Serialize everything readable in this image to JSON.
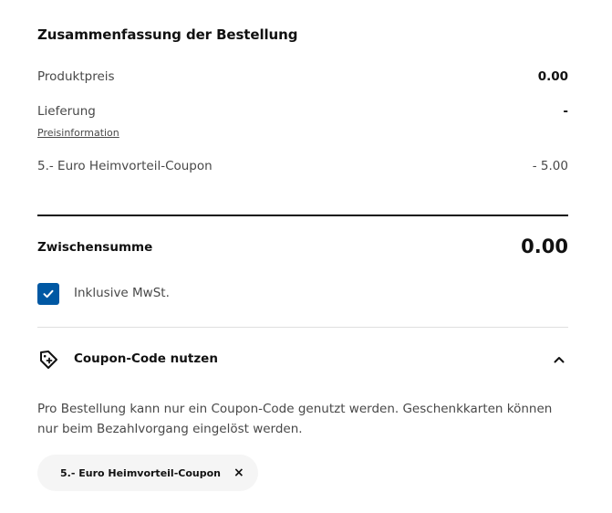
{
  "summary": {
    "title": "Zusammenfassung der Bestellung",
    "rows": [
      {
        "label": "Produktpreis",
        "value": "0.00"
      },
      {
        "label": "Lieferung",
        "value": "-",
        "link": "Preisinformation"
      },
      {
        "label": "5.- Euro Heimvorteil-Coupon",
        "value": "- 5.00"
      }
    ]
  },
  "subtotal": {
    "label": "Zwischensumme",
    "value": "0.00"
  },
  "vat": {
    "label": "Inklusive MwSt.",
    "checked": true
  },
  "coupon": {
    "title": "Coupon-Code nutzen",
    "expanded": true,
    "info": "Pro Bestellung kann nur ein Coupon-Code genutzt werden. Geschenkkarten können nur beim Bezahlvorgang eingelöst werden.",
    "applied_label": "5.- Euro Heimvorteil-Coupon",
    "remove_symbol": "×"
  },
  "colors": {
    "accent": "#0058a3",
    "divider": "#111111",
    "chip_bg": "#f5f5f5"
  }
}
